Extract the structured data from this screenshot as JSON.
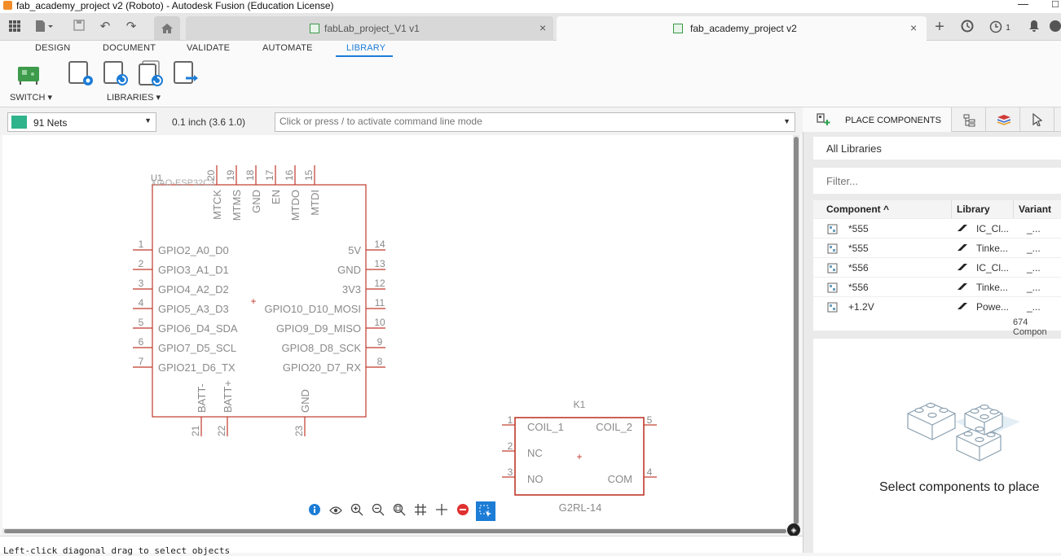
{
  "window": {
    "title": "fab_academy_project v2 (Roboto) - Autodesk Fusion (Education License)",
    "minimize": "—",
    "maximize": "□"
  },
  "doc_tabs": [
    {
      "label": "fabLab_project_V1 v1",
      "close": "×",
      "active": false
    },
    {
      "label": "fab_academy_project v2",
      "close": "×",
      "active": true
    }
  ],
  "topbar": {
    "notifications_count": "1"
  },
  "ribbon": {
    "tabs": [
      "DESIGN",
      "DOCUMENT",
      "VALIDATE",
      "AUTOMATE",
      "LIBRARY"
    ],
    "active_tab": "LIBRARY",
    "switch_label": "SWITCH ▾",
    "libraries_label": "LIBRARIES ▾"
  },
  "toolbar": {
    "nets_label": "91 Nets",
    "nets_color": "#2fb38a",
    "grid_info": "0.1 inch (3.6 1.0)",
    "cmd_placeholder": "Click or press / to activate command line mode"
  },
  "schematic": {
    "u1": {
      "name": "U1",
      "value": "XIAO-ESP32C3",
      "top_pins": [
        {
          "num": "20",
          "name": "MTCK"
        },
        {
          "num": "19",
          "name": "MTMS"
        },
        {
          "num": "18",
          "name": "GND"
        },
        {
          "num": "17",
          "name": "EN"
        },
        {
          "num": "16",
          "name": "MTDO"
        },
        {
          "num": "15",
          "name": "MTDI"
        }
      ],
      "left_pins": [
        {
          "num": "1",
          "name": "GPIO2_A0_D0"
        },
        {
          "num": "2",
          "name": "GPIO3_A1_D1"
        },
        {
          "num": "3",
          "name": "GPIO4_A2_D2"
        },
        {
          "num": "4",
          "name": "GPIO5_A3_D3"
        },
        {
          "num": "5",
          "name": "GPIO6_D4_SDA"
        },
        {
          "num": "6",
          "name": "GPIO7_D5_SCL"
        },
        {
          "num": "7",
          "name": "GPIO21_D6_TX"
        }
      ],
      "right_pins": [
        {
          "num": "14",
          "name": "5V"
        },
        {
          "num": "13",
          "name": "GND"
        },
        {
          "num": "12",
          "name": "3V3"
        },
        {
          "num": "11",
          "name": "GPIO10_D10_MOSI"
        },
        {
          "num": "10",
          "name": "GPIO9_D9_MISO"
        },
        {
          "num": "9",
          "name": "GPIO8_D8_SCK"
        },
        {
          "num": "8",
          "name": "GPIO20_D7_RX"
        }
      ],
      "bottom_pins": [
        {
          "num": "21",
          "name": "BATT-"
        },
        {
          "num": "22",
          "name": "BATT+"
        },
        {
          "num": "23",
          "name": "GND"
        }
      ]
    },
    "k1": {
      "name": "K1",
      "value": "G2RL-14",
      "left_pins": [
        {
          "num": "1",
          "name": "COIL_1"
        },
        {
          "num": "2",
          "name": "NC"
        },
        {
          "num": "3",
          "name": "NO"
        }
      ],
      "right_pins": [
        {
          "num": "5",
          "name": "COIL_2"
        },
        {
          "num": "4",
          "name": "COM"
        }
      ]
    },
    "color": "#c0392b",
    "label_color": "#8a8a8a"
  },
  "status": {
    "hint": "Left-click diagonal drag to select objects"
  },
  "panel": {
    "tabs": [
      "PLACE COMPONENTS"
    ],
    "library_select": "All Libraries",
    "filter_placeholder": "Filter...",
    "columns": [
      "Component ^",
      "Library",
      "Variant"
    ],
    "rows": [
      {
        "component": "*555",
        "library": "IC_Cl...",
        "variant": "_..."
      },
      {
        "component": "*555",
        "library": "Tinke...",
        "variant": "_..."
      },
      {
        "component": "*556",
        "library": "IC_Cl...",
        "variant": "_..."
      },
      {
        "component": "*556",
        "library": "Tinke...",
        "variant": "_..."
      },
      {
        "component": "+1.2V",
        "library": "Powe...",
        "variant": "_..."
      }
    ],
    "count": "674 Compon",
    "empty_message": "Select components to place"
  }
}
